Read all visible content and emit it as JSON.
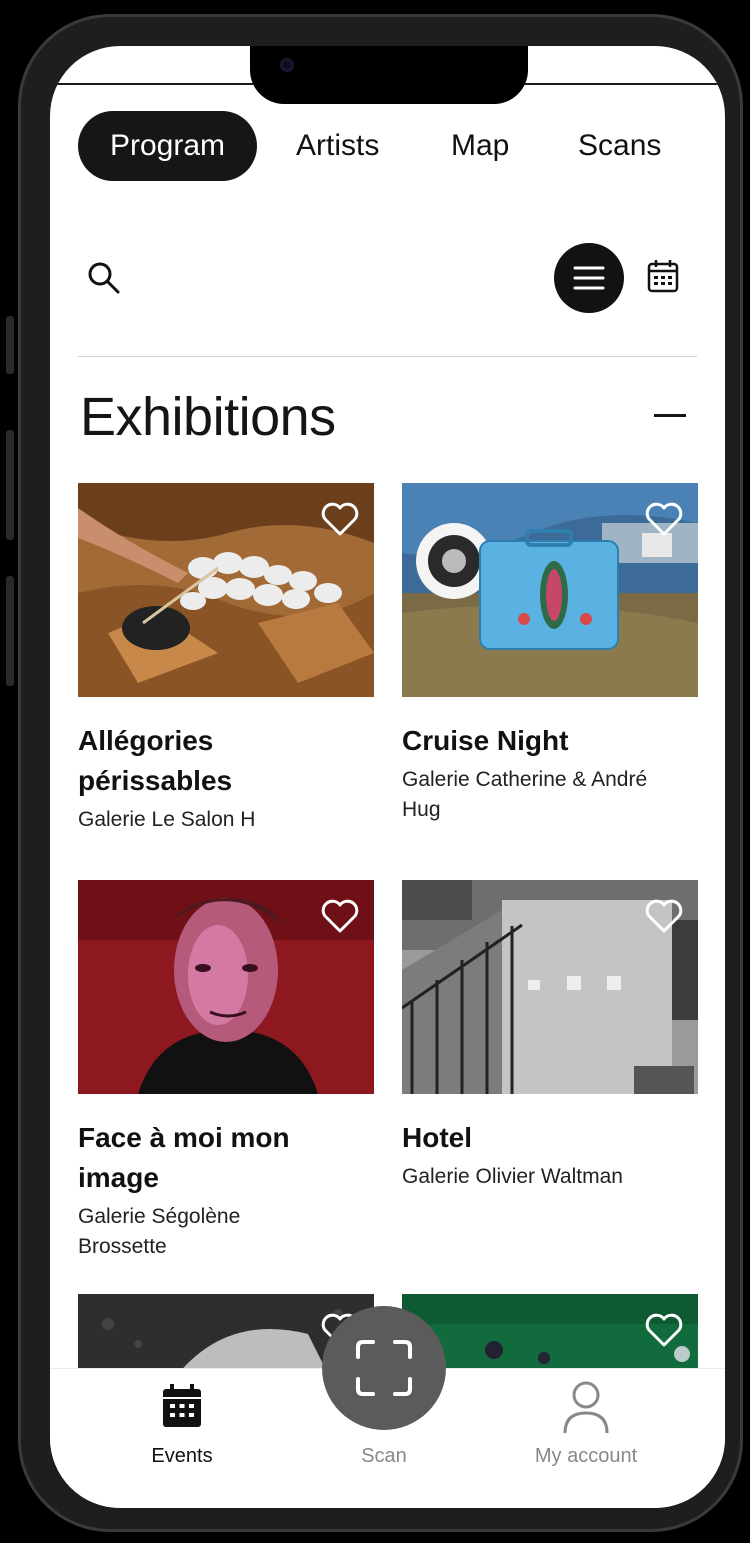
{
  "tabs": [
    {
      "label": "Program",
      "active": true
    },
    {
      "label": "Artists",
      "active": false
    },
    {
      "label": "Map",
      "active": false
    },
    {
      "label": "Scans",
      "active": false
    }
  ],
  "toolbar": {
    "search_icon": "search-icon",
    "list_icon": "menu-icon",
    "calendar_icon": "calendar-icon"
  },
  "section": {
    "title": "Exhibitions",
    "collapse_icon": "minus-icon"
  },
  "cards": [
    {
      "title_line1": "Allégories",
      "title_line2": "périssables",
      "sub_line1": "Galerie Le Salon H",
      "sub_line2": ""
    },
    {
      "title_line1": "Cruise Night",
      "title_line2": "",
      "sub_line1": "Galerie Catherine & André",
      "sub_line2": "Hug"
    },
    {
      "title_line1": "Face à moi mon",
      "title_line2": "image",
      "sub_line1": "Galerie Ségolène",
      "sub_line2": "Brossette"
    },
    {
      "title_line1": "Hotel",
      "title_line2": "",
      "sub_line1": "Galerie Olivier Waltman",
      "sub_line2": ""
    }
  ],
  "bottom_nav": {
    "events": "Events",
    "scan": "Scan",
    "account": "My account"
  },
  "colors": {
    "active_tab": "#161616",
    "scan_button": "#5b5b5b",
    "accent_dark": "#121212"
  }
}
